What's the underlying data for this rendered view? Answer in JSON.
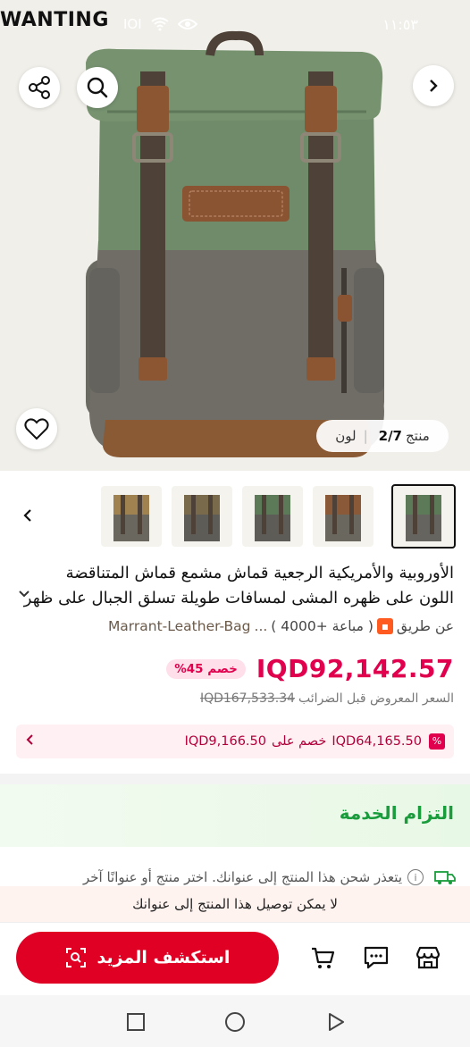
{
  "status_bar": {
    "left_text": "WANTING",
    "time": "١١:٥٣",
    "signal": "IOI"
  },
  "hero": {
    "counter_prefix": "منتج",
    "counter_value": "2/7",
    "color_label": "لون",
    "icons": {
      "share": "share-icon",
      "search": "search-icon",
      "next": "chevron-right-icon",
      "wishlist": "heart-icon"
    }
  },
  "thumbnails": {
    "count": 5,
    "selected_index": 0,
    "prev_icon": "chevron-left-icon",
    "colors": [
      "#4e6348",
      "#7a6a4c",
      "#5d7a58",
      "#8a5a38",
      "#a08250"
    ]
  },
  "product": {
    "title_line1": "الأوروبية والأمريكية الرجعية قماش مشمع قماش المتناقضة",
    "title_line2": "اللون على ظهره المشى لمسافات طويلة تسلق الجبال على ظهر",
    "seller_prefix": "عن طريق",
    "seller_sold": "( مباعة +4000 )",
    "seller_ellipsis": "...",
    "seller_name": "Marrant-Leather-Bag"
  },
  "pricing": {
    "price": "IQD92,142.57",
    "discount_badge": "خصم 45%",
    "old_price": "IQD167,533.34",
    "old_price_label": "السعر المعروض قبل الضرائب",
    "coupon_amount": "IQD64,165.50",
    "coupon_label": "خصم على",
    "coupon_threshold": "IQD9,166.50",
    "accent_color": "#e0004d"
  },
  "service": {
    "title": "التزام الخدمة",
    "title_color": "#1a9c3c"
  },
  "shipping": {
    "note": "يتعذر شحن هذا المنتج إلى عنوانك. اختر منتج أو عنوانًا آخر",
    "alert": "لا يمكن توصيل هذا المنتج إلى عنوانك"
  },
  "bottom_bar": {
    "explore_label": "استكشف المزيد",
    "cart_icon": "cart-icon",
    "chat_icon": "chat-icon",
    "store_icon": "store-icon"
  }
}
